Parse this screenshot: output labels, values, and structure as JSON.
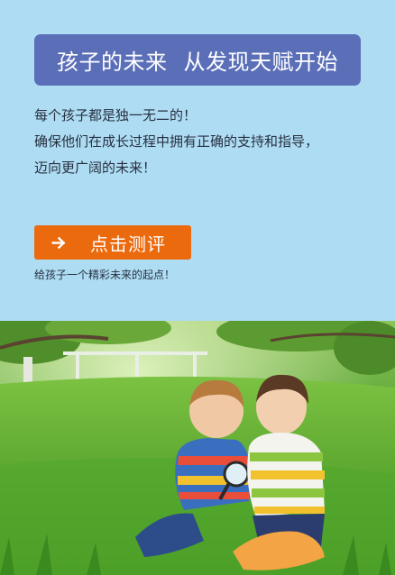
{
  "banner": {
    "part1": "孩子的未来",
    "part2": "从发现天赋开始"
  },
  "intro": {
    "lines": [
      "每个孩子都是独一无二的！",
      "确保他们在成长过程中拥有正确的支持和指导，",
      "迈向更广阔的未来！"
    ]
  },
  "cta": {
    "label": "点击测评",
    "icon": "arrow-right-icon"
  },
  "subnote": "给孩子一个精彩未来的起点！",
  "photo": {
    "subject": "two-boys-with-magnifying-glass"
  },
  "colors": {
    "background": "#aedcf3",
    "banner": "#5b6fb8",
    "cta": "#ec6a0e"
  }
}
